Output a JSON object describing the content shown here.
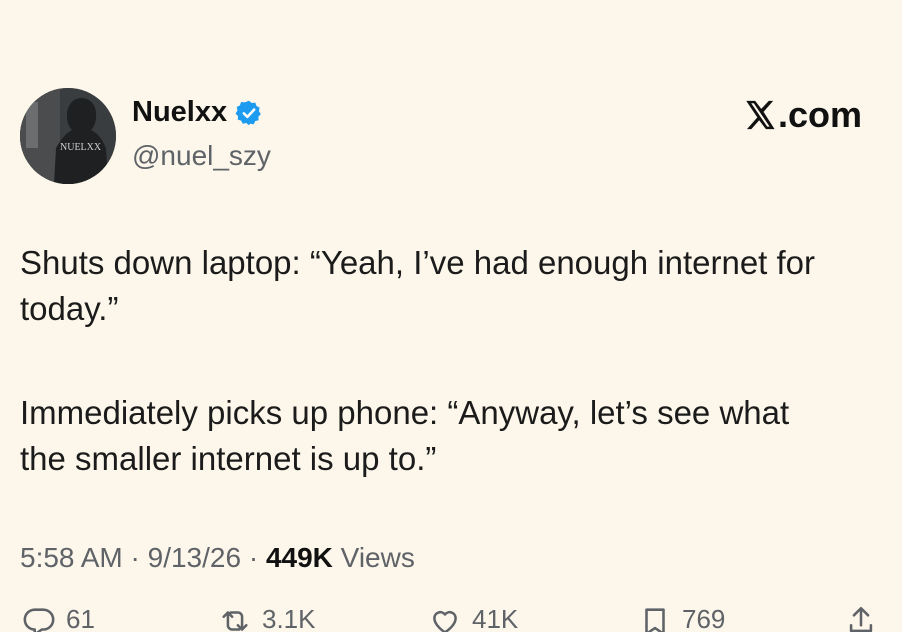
{
  "author": {
    "display_name": "Nuelxx",
    "handle": "@nuel_szy",
    "avatar_text": "NUELXX",
    "verified": true,
    "verified_color": "#1d9bf0"
  },
  "brand": {
    "label": ".com"
  },
  "post": {
    "paragraph_1": "Shuts down laptop: “Yeah, I’ve had enough internet for today.”",
    "paragraph_2": "Immediately picks up phone: “Anyway, let’s see what the smaller internet is up to.”"
  },
  "meta": {
    "time": "5:58 AM",
    "date": "9/13/26",
    "separator": " · ",
    "views_count": "449K",
    "views_label": " Views"
  },
  "actions": {
    "replies": "61",
    "reposts": "3.1K",
    "likes": "41K",
    "bookmarks": "769"
  },
  "icons": {
    "reply": "reply-icon",
    "repost": "repost-icon",
    "like": "heart-icon",
    "bookmark": "bookmark-icon",
    "share": "share-icon",
    "brand": "x-logo-icon",
    "verified": "verified-badge-icon"
  },
  "colors": {
    "background": "#fcf7ea",
    "text": "#1b1b1b",
    "muted": "#5f6368"
  }
}
